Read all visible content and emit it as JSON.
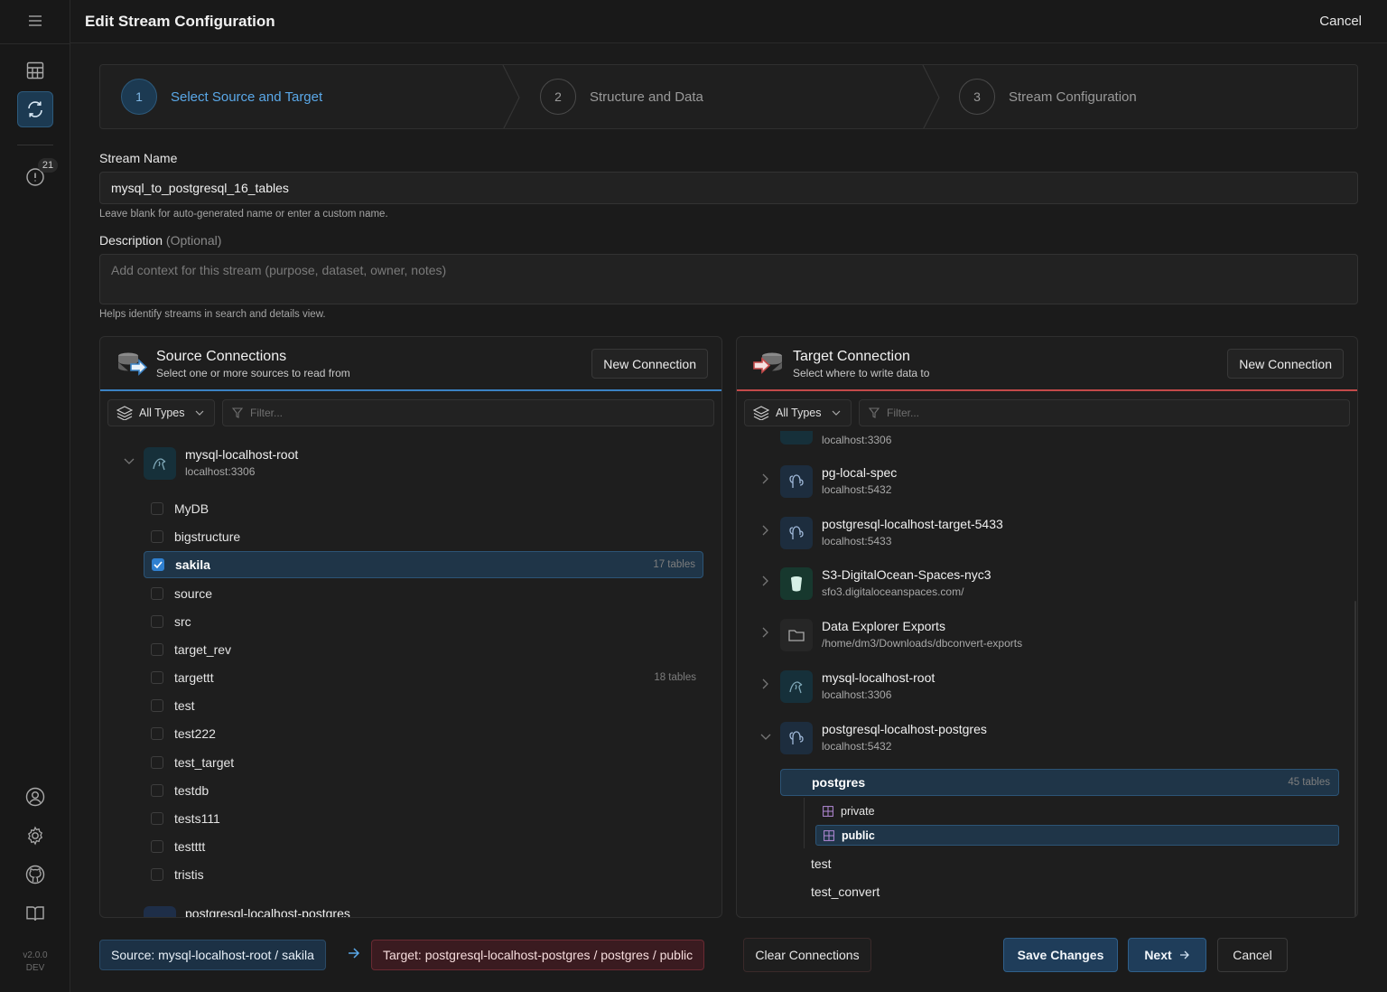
{
  "app": {
    "version_line1": "v2.0.0",
    "version_line2": "DEV",
    "notification_count": "21"
  },
  "header": {
    "title": "Edit Stream Configuration",
    "cancel_label": "Cancel"
  },
  "stepper": {
    "steps": [
      {
        "number": "1",
        "label": "Select Source and Target",
        "active": true
      },
      {
        "number": "2",
        "label": "Structure and Data",
        "active": false
      },
      {
        "number": "3",
        "label": "Stream Configuration",
        "active": false
      }
    ]
  },
  "form": {
    "stream_name_label": "Stream Name",
    "stream_name_value": "mysql_to_postgresql_16_tables",
    "stream_name_hint": "Leave blank for auto-generated name or enter a custom name.",
    "description_label": "Description",
    "description_optional": "(Optional)",
    "description_placeholder": "Add context for this stream (purpose, dataset, owner, notes)",
    "description_hint": "Helps identify streams in search and details view."
  },
  "source_panel": {
    "title": "Source Connections",
    "subtitle": "Select one or more sources to read from",
    "new_connection_label": "New Connection",
    "types_label": "All Types",
    "filter_placeholder": "Filter...",
    "accent_color": "#3b82c4",
    "connection": {
      "name": "mysql-localhost-root",
      "host": "localhost:3306"
    },
    "databases": [
      {
        "name": "MyDB",
        "count": "",
        "selected": false
      },
      {
        "name": "bigstructure",
        "count": "",
        "selected": false
      },
      {
        "name": "sakila",
        "count": "17 tables",
        "selected": true
      },
      {
        "name": "source",
        "count": "",
        "selected": false
      },
      {
        "name": "src",
        "count": "",
        "selected": false
      },
      {
        "name": "target_rev",
        "count": "",
        "selected": false
      },
      {
        "name": "targettt",
        "count": "18 tables",
        "selected": false
      },
      {
        "name": "test",
        "count": "",
        "selected": false
      },
      {
        "name": "test222",
        "count": "",
        "selected": false
      },
      {
        "name": "test_target",
        "count": "",
        "selected": false
      },
      {
        "name": "testdb",
        "count": "",
        "selected": false
      },
      {
        "name": "tests111",
        "count": "",
        "selected": false
      },
      {
        "name": "testttt",
        "count": "",
        "selected": false
      },
      {
        "name": "tristis",
        "count": "",
        "selected": false
      }
    ],
    "next_connection": {
      "name": "postgresql-localhost-postgres"
    }
  },
  "target_panel": {
    "title": "Target Connection",
    "subtitle": "Select where to write data to",
    "new_connection_label": "New Connection",
    "types_label": "All Types",
    "filter_placeholder": "Filter...",
    "accent_color": "#c44a4a",
    "top_partial_host": "localhost:3306",
    "connections": [
      {
        "name": "pg-local-spec",
        "host": "localhost:5432",
        "icon": "postgres-icon"
      },
      {
        "name": "postgresql-localhost-target-5433",
        "host": "localhost:5433",
        "icon": "postgres-icon"
      },
      {
        "name": "S3-DigitalOcean-Spaces-nyc3",
        "host": "sfo3.digitaloceanspaces.com/",
        "icon": "bucket-icon"
      },
      {
        "name": "Data Explorer Exports",
        "host": "/home/dm3/Downloads/dbconvert-exports",
        "icon": "folder-icon"
      },
      {
        "name": "mysql-localhost-root",
        "host": "localhost:3306",
        "icon": "mysql-icon"
      },
      {
        "name": "postgresql-localhost-postgres",
        "host": "localhost:5432",
        "icon": "postgres-icon"
      }
    ],
    "databases": [
      {
        "name": "postgres",
        "count": "45 tables",
        "selected": true
      },
      {
        "name": "test",
        "count": ""
      },
      {
        "name": "test_convert",
        "count": ""
      }
    ],
    "schemas": [
      {
        "name": "private",
        "selected": false
      },
      {
        "name": "public",
        "selected": true
      }
    ]
  },
  "footer": {
    "source_pill": "Source: mysql-localhost-root / sakila",
    "target_pill": "Target: postgresql-localhost-postgres / postgres / public",
    "clear_label": "Clear Connections",
    "save_label": "Save Changes",
    "next_label": "Next",
    "cancel_label": "Cancel"
  }
}
